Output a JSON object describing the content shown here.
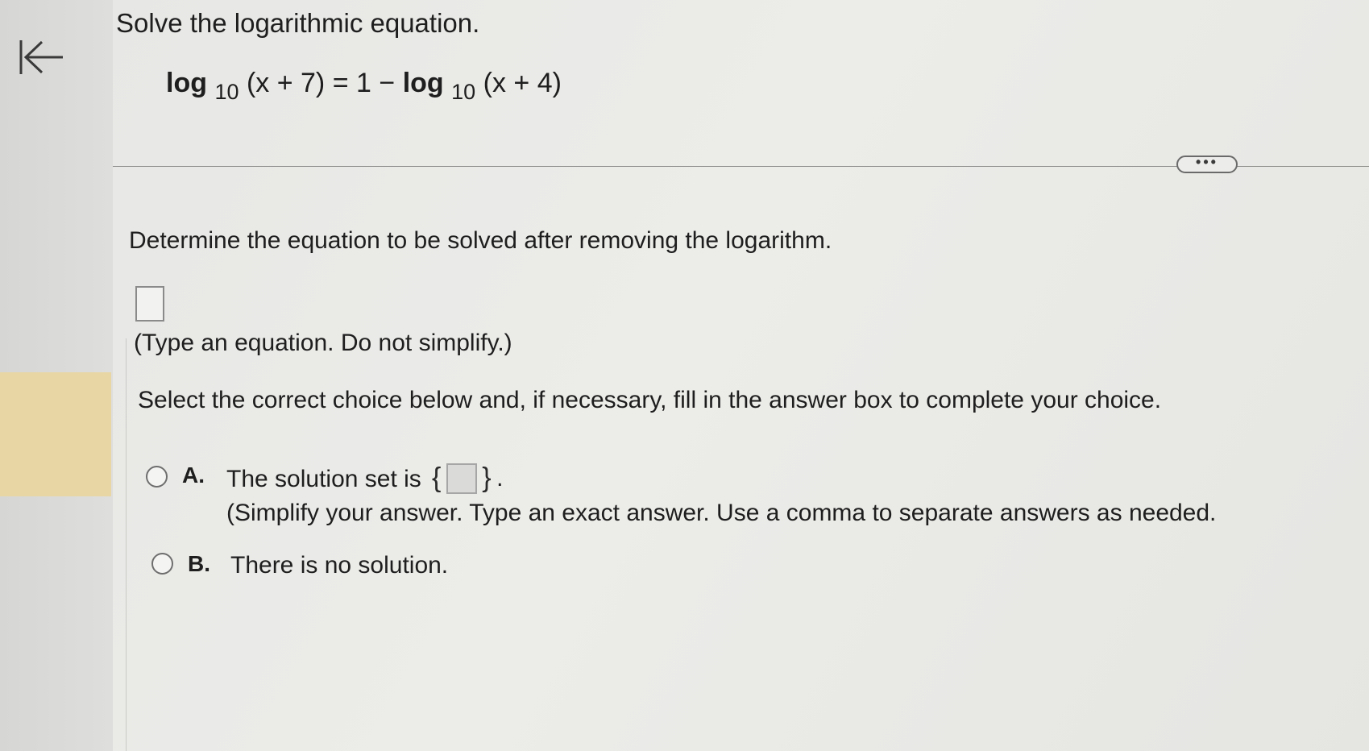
{
  "nav": {
    "back_icon": "back-to-start-icon"
  },
  "problem": {
    "title": "Solve the logarithmic equation.",
    "equation": {
      "left_fn": "log",
      "left_base": "10",
      "left_arg": "(x + 7)",
      "equals": "=",
      "constant": "1",
      "minus": "−",
      "right_fn": "log",
      "right_base": "10",
      "right_arg": "(x + 4)"
    }
  },
  "toolbar": {
    "more_label": "•••"
  },
  "step": {
    "prompt": "Determine the equation to be solved after removing the logarithm.",
    "answer_value": "",
    "hint": "(Type an equation. Do not simplify.)"
  },
  "choices": {
    "prompt": "Select the correct choice below and, if necessary, fill in the answer box to complete your choice.",
    "options": [
      {
        "letter": "A.",
        "text": "The solution set is",
        "open_brace": "{",
        "close_brace": "}",
        "period": ".",
        "answer_value": "",
        "hint": "(Simplify your answer. Type an exact answer. Use a comma to separate answers as needed."
      },
      {
        "letter": "B.",
        "text": "There is no solution."
      }
    ]
  },
  "colors": {
    "sidebar_highlight": "#e8d6a4",
    "text": "#1e1e1e",
    "background": "#e7e7e5"
  }
}
